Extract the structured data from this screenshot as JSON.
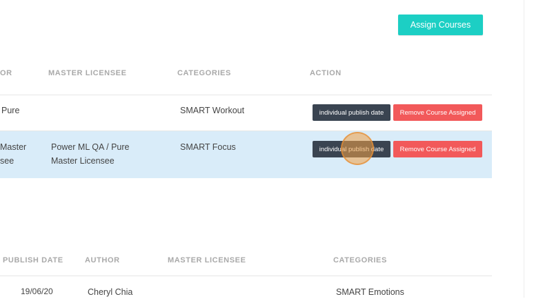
{
  "toolbar": {
    "assign_courses_label": "Assign Courses"
  },
  "table1": {
    "headers": {
      "author_partial": "OR",
      "master_licensee": "MASTER LICENSEE",
      "categories": "CATEGORIES",
      "action": "ACTION"
    },
    "rows": [
      {
        "author_partial": "Pure",
        "master_licensee_line1": "",
        "master_licensee_line2": "",
        "category": "SMART Workout",
        "publish_btn": "individual publish date",
        "remove_btn": "Remove Course Assigned"
      },
      {
        "author_partial_line1": "Master",
        "author_partial_line2": "see",
        "master_licensee_line1": "Power ML QA / Pure",
        "master_licensee_line2": "Master Licensee",
        "category": "SMART Focus",
        "publish_btn": "individual publish date",
        "remove_btn": "Remove Course Assigned"
      }
    ]
  },
  "table2": {
    "headers": {
      "publish_date": "PUBLISH DATE",
      "author": "AUTHOR",
      "master_licensee": "MASTER LICENSEE",
      "categories": "CATEGORIES"
    },
    "rows": [
      {
        "publish_date": "19/06/20",
        "author": "Cheryl Chia",
        "category": "SMART Emotions"
      }
    ]
  },
  "colors": {
    "accent": "#1ccfc4",
    "dark_button": "#3a4451",
    "danger_button": "#f2595a",
    "row_highlight": "#d9ecf9"
  }
}
